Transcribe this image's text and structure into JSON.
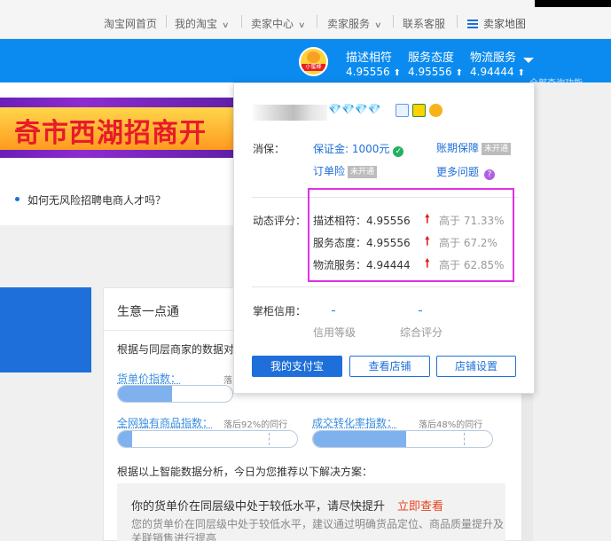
{
  "topnav": {
    "items": [
      "淘宝网首页",
      "我的淘宝",
      "卖家中心",
      "卖家服务",
      "联系客服",
      "卖家地图"
    ]
  },
  "bluebar": {
    "avatar_tag": "小蜜蜂",
    "scores": [
      {
        "label": "描述相符",
        "value": "4.95556"
      },
      {
        "label": "服务态度",
        "value": "4.95556"
      },
      {
        "label": "物流服务",
        "value": "4.94444"
      }
    ],
    "arrow_glyph": "⬆",
    "truncated": "全部查询功能"
  },
  "background": {
    "banner_text": "奇市西湖招商开",
    "news": "如何无风险招聘电商人才吗？",
    "panel_title": "生意一点通",
    "panel_intro": "根据与同层商家的数据对",
    "metrics": [
      {
        "label": "货单价指数：",
        "note": "落",
        "fill": 0.47
      },
      {
        "label": "全网独有商品指数：",
        "note": "落后92%的同行",
        "fill": 0.08
      },
      {
        "label": "成交转化率指数：",
        "note": "落后48%的同行",
        "fill": 0.52
      }
    ],
    "recommend": "根据以上智能数据分析，今日为您推荐以下解决方案：",
    "suggest_title": "你的货单价在同层级中处于较低水平，请尽快提升",
    "suggest_link": "立即查看",
    "suggest_body_1": "您的货单价在同层级中处于较低水平，建议通过明确货品定位、商品质量提升及",
    "suggest_body_2": "关联销售进行提高"
  },
  "popup": {
    "diamonds": "💎💎💎💎",
    "protection_label": "消保：",
    "deposit_link": "保证金: 1000元",
    "account_link": "账期保障",
    "not_open": "未开通",
    "order_insurance": "订单险",
    "more_questions": "更多问题",
    "dsr_label": "动态评分：",
    "dsr": [
      {
        "name": "描述相符：4.95556",
        "compare": "高于 71.33%"
      },
      {
        "name": "服务态度：4.95556",
        "compare": "高于 67.2%"
      },
      {
        "name": "物流服务：4.94444",
        "compare": "高于 62.85%"
      }
    ],
    "up_glyph": "🠕",
    "shopkeeper_label": "掌柜信用：",
    "credit_level": "信用等级",
    "overall_score": "综合评分",
    "buttons": [
      "我的支付宝",
      "查看店铺",
      "店铺设置"
    ]
  },
  "colors": {
    "brand_blue": "#0B8BEF",
    "link_blue": "#1E6FD9",
    "highlight": "#E031E0",
    "up_red": "#E02020"
  }
}
